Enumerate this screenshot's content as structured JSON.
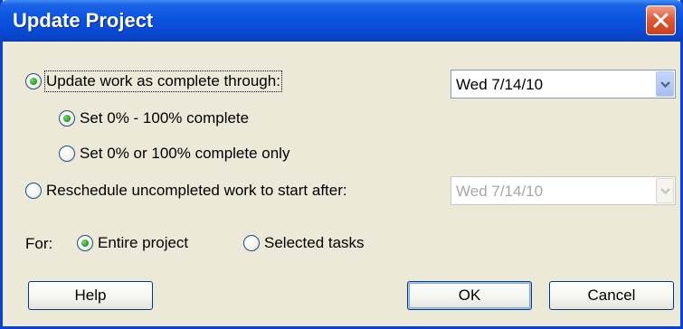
{
  "window": {
    "title": "Update Project"
  },
  "options": {
    "update_work": {
      "label": "Update work as complete through:",
      "date": "Wed 7/14/10"
    },
    "set_range": {
      "label": "Set 0% - 100% complete"
    },
    "set_binary": {
      "label": "Set 0% or 100% complete only"
    },
    "reschedule": {
      "label": "Reschedule uncompleted work to start after:",
      "date": "Wed 7/14/10"
    }
  },
  "scope": {
    "label": "For:",
    "entire": "Entire project",
    "selected": "Selected tasks"
  },
  "buttons": {
    "help": "Help",
    "ok": "OK",
    "cancel": "Cancel"
  },
  "colors": {
    "titlebar": "#0a53e0",
    "dialog_bg": "#ece9d8",
    "close": "#e05a36"
  }
}
